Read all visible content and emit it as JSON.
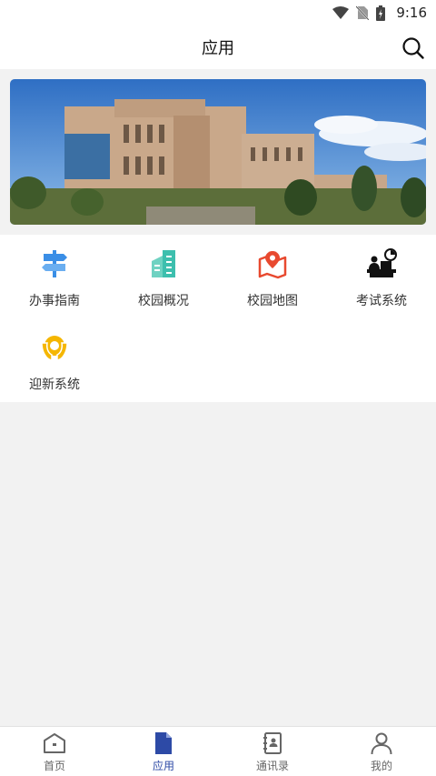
{
  "status_bar": {
    "time": "9:16",
    "icons": [
      "wifi-icon",
      "no-sim-icon",
      "battery-charging-icon"
    ]
  },
  "header": {
    "title": "应用",
    "search_icon": "search-icon"
  },
  "apps": [
    {
      "label": "办事指南",
      "icon": "signpost-icon",
      "color": "#3a8ee6"
    },
    {
      "label": "校园概况",
      "icon": "building-icon",
      "color": "#3dbfae"
    },
    {
      "label": "校园地图",
      "icon": "map-pin-icon",
      "color": "#e8492f"
    },
    {
      "label": "考试系统",
      "icon": "exam-desk-icon",
      "color": "#111111"
    },
    {
      "label": "迎新系统",
      "icon": "welcome-hands-icon",
      "color": "#f5b600"
    }
  ],
  "tabs": [
    {
      "label": "首页",
      "icon": "home-icon",
      "active": false
    },
    {
      "label": "应用",
      "icon": "document-icon",
      "active": true
    },
    {
      "label": "通讯录",
      "icon": "contacts-book-icon",
      "active": false
    },
    {
      "label": "我的",
      "icon": "user-icon",
      "active": false
    }
  ],
  "colors": {
    "accent": "#2d4aa6",
    "inactive": "#666666",
    "background": "#f2f2f2"
  }
}
